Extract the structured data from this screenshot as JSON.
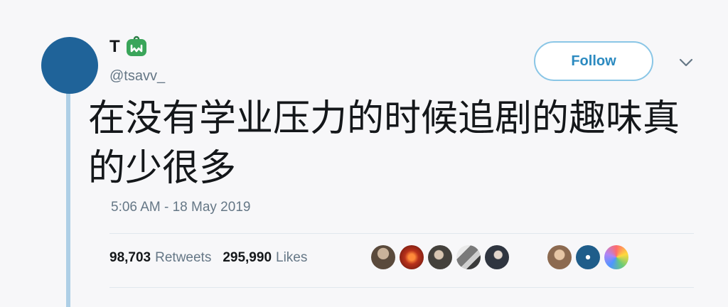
{
  "user": {
    "display_name": "T",
    "handle": "@tsavv_",
    "avatar_color": "#1f6399"
  },
  "actions": {
    "follow_label": "Follow",
    "menu_icon": "chevron-down-icon"
  },
  "tweet": {
    "text": "在没有学业压力的时候追剧的趣味真的少很多",
    "timestamp": "5:06 AM - 18 May 2019"
  },
  "stats": {
    "retweets_count": "98,703",
    "retweets_label": "Retweets",
    "likes_count": "295,990",
    "likes_label": "Likes"
  },
  "liked_by": {
    "count_visible": 8
  },
  "colors": {
    "accent": "#2b8ac0",
    "thread_line": "#aecfe6",
    "muted_text": "#657786"
  }
}
